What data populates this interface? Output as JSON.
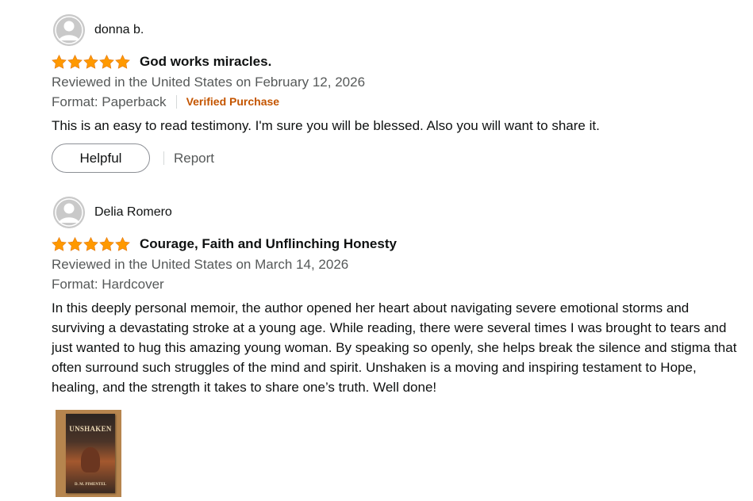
{
  "colors": {
    "star": "#ff9900",
    "verified": "#c45500",
    "meta_text": "#565959",
    "body_text": "#0f1111"
  },
  "reviews": [
    {
      "reviewer": "donna b.",
      "rating": 5,
      "title": "God works miracles.",
      "date_line": "Reviewed in the United States on February 12, 2026",
      "format": "Format: Paperback",
      "verified": "Verified Purchase",
      "body": "This is an easy to read testimony. I'm sure you will be blessed. Also you will want to share it.",
      "helpful_label": "Helpful",
      "report_label": "Report",
      "avatar_icon": "default-user-avatar-icon"
    },
    {
      "reviewer": "Delia Romero",
      "rating": 5,
      "title": "Courage, Faith and Unflinching Honesty",
      "date_line": "Reviewed in the United States on March 14, 2026",
      "format": "Format: Hardcover",
      "body": "In this deeply personal memoir, the author opened her heart about navigating severe emotional storms and surviving a devastating stroke at a young age. While reading, there were several times I was brought to tears and just wanted to hug this amazing young woman. By speaking so openly, she helps break the silence and stigma that often surround such struggles of the mind and spirit. Unshaken is a moving and inspiring testament to Hope, healing, and the strength it takes to share one’s truth. Well done!",
      "avatar_icon": "default-user-avatar-icon",
      "image": {
        "book_title": "UNSHAKEN",
        "book_author": "D. M. PIMENTEL"
      }
    }
  ]
}
